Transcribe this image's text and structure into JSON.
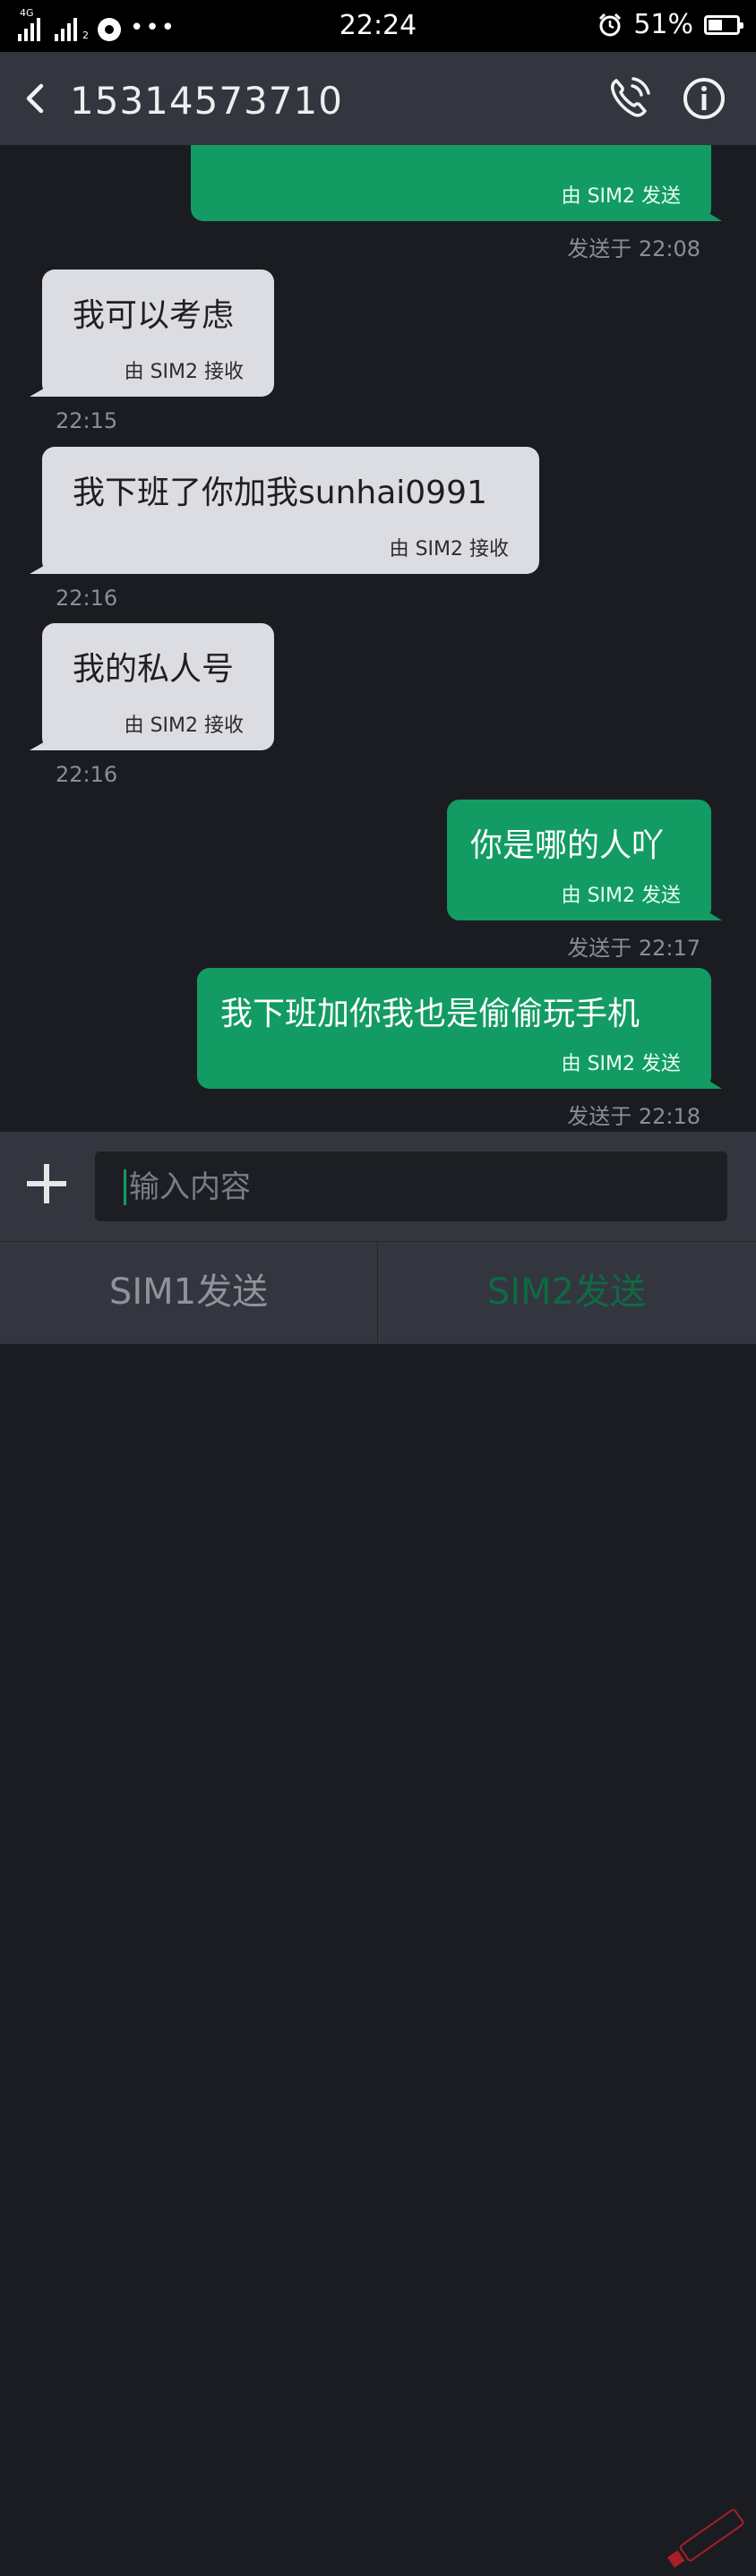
{
  "status_bar": {
    "network": "4G",
    "sim2_marker": "2",
    "more": "•••",
    "time": "22:24",
    "battery_percent": "51%",
    "battery_level": 0.51,
    "icons": [
      "signal-sim1-icon",
      "signal-sim2-icon",
      "media-icon",
      "alarm-icon",
      "battery-icon"
    ]
  },
  "header": {
    "title": "15314573710",
    "icons": [
      "back-icon",
      "phone-call-icon",
      "info-icon"
    ]
  },
  "messages": [
    {
      "direction": "sent",
      "text": "",
      "sim": "由 SIM2 发送",
      "timestamp": "发送于 22:08"
    },
    {
      "direction": "received",
      "text": "我可以考虑",
      "sim": "由 SIM2 接收",
      "timestamp": "22:15"
    },
    {
      "direction": "received",
      "text": "我下班了你加我sunhai0991",
      "sim": "由 SIM2 接收",
      "timestamp": "22:16"
    },
    {
      "direction": "received",
      "text": "我的私人号",
      "sim": "由 SIM2 接收",
      "timestamp": "22:16"
    },
    {
      "direction": "sent",
      "text": "你是哪的人吖",
      "sim": "由 SIM2 发送",
      "timestamp": "发送于 22:17"
    },
    {
      "direction": "sent",
      "text": "我下班加你我也是偷偷玩手机",
      "sim": "由 SIM2 发送",
      "timestamp": "发送于 22:18"
    }
  ],
  "composer": {
    "placeholder": "输入内容",
    "value": "",
    "icons": [
      "plus-icon"
    ]
  },
  "send_buttons": {
    "sim1": "SIM1发送",
    "sim2": "SIM2发送"
  },
  "colors": {
    "sent_bubble": "#139b64",
    "received_bubble": "#dcdde3",
    "background": "#1b1c21",
    "bar": "#33363f"
  }
}
